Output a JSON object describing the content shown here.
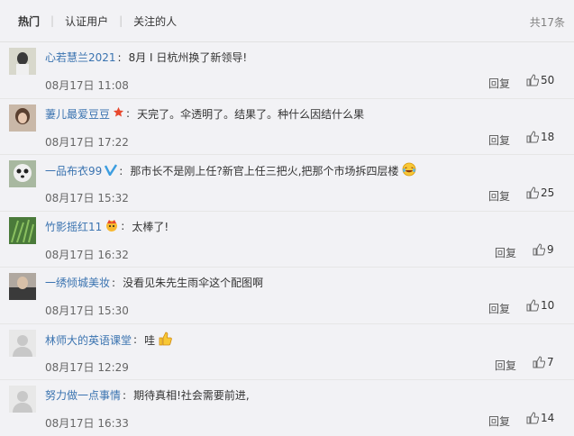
{
  "tabs": [
    {
      "label": "热门"
    },
    {
      "label": "认证用户"
    },
    {
      "label": "关注的人"
    }
  ],
  "total": "共17条",
  "reply_label": "回复",
  "comments": [
    {
      "user": "心若慧兰2021",
      "text": "8月 I 日杭州换了新领导!",
      "time": "08月17日 11:08",
      "likes": "50"
    },
    {
      "user": "萋儿最爱豆豆",
      "text": "天完了。伞透明了。结果了。种什么因结什么果",
      "time": "08月17日 17:22",
      "likes": "18"
    },
    {
      "user": "一品布衣99",
      "text": "那市长不是刚上任?新官上任三把火,把那个市场拆四层楼",
      "time": "08月17日 15:32",
      "likes": "25"
    },
    {
      "user": "竹影摇红11",
      "text": "太棒了!",
      "time": "08月17日 16:32",
      "likes": "9"
    },
    {
      "user": "一绣倾城美妆",
      "text": "没看见朱先生雨伞这个配图啊",
      "time": "08月17日 15:30",
      "likes": "10"
    },
    {
      "user": "林师大的英语课堂",
      "text": "哇",
      "time": "08月17日 12:29",
      "likes": "7"
    },
    {
      "user": "努力做一点事情",
      "text": "期待真相!社会需要前进,",
      "time": "08月17日 16:33",
      "likes": "14"
    }
  ]
}
